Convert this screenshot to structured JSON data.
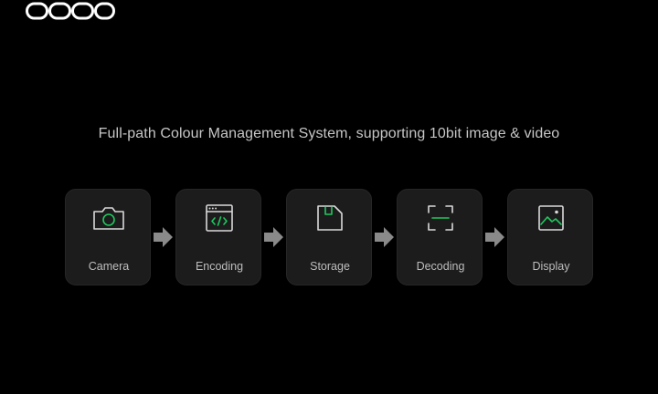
{
  "brand": {
    "logo_text": "oppo"
  },
  "headline": "Full-path Colour Management System, supporting 10bit image & video",
  "pipeline": {
    "stages": [
      {
        "label": "Camera",
        "icon": "camera-icon"
      },
      {
        "label": "Encoding",
        "icon": "code-window-icon"
      },
      {
        "label": "Storage",
        "icon": "sd-card-icon"
      },
      {
        "label": "Decoding",
        "icon": "scan-frame-icon"
      },
      {
        "label": "Display",
        "icon": "image-icon"
      }
    ]
  },
  "colors": {
    "background": "#000000",
    "card": "#1c1c1c",
    "icon_stroke": "#d9d9d9",
    "accent_green": "#1fc85f",
    "arrow": "#8a8a8a"
  }
}
